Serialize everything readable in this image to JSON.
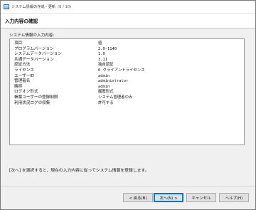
{
  "window": {
    "title": "システム情報の作成・更新",
    "step": "(8 / 10)"
  },
  "header": {
    "title": "入力内容の確認"
  },
  "group": {
    "label": "システム情報の入力内容:"
  },
  "table": {
    "columns": [
      "項目",
      "値"
    ],
    "rows": [
      [
        "プログラムバージョン",
        "2.0-1140"
      ],
      [
        "システムデータバージョン",
        "1.0"
      ],
      [
        "共通データバージョン",
        "3.11"
      ],
      [
        "認証方法",
        "独自認証"
      ],
      [
        "ライセンス",
        "0 クライアントライセンス"
      ],
      [
        "ユーザーID",
        "admin"
      ],
      [
        "管理者名",
        "administrator"
      ],
      [
        "略称",
        "admin"
      ],
      [
        "ログオン形式",
        "履歴形式"
      ],
      [
        "帳票ユーザーの登録制限",
        "システム管理者のみ"
      ],
      [
        "利用状況ログの収集",
        "許可する"
      ]
    ]
  },
  "note": "[次へ] を選択すると、現在の入力内容に従ってシステム情報を登録します。",
  "buttons": {
    "back": "< 戻る(B)",
    "next": "次へ(N) >",
    "cancel": "キャンセル",
    "help": "ヘルプ(H)"
  }
}
